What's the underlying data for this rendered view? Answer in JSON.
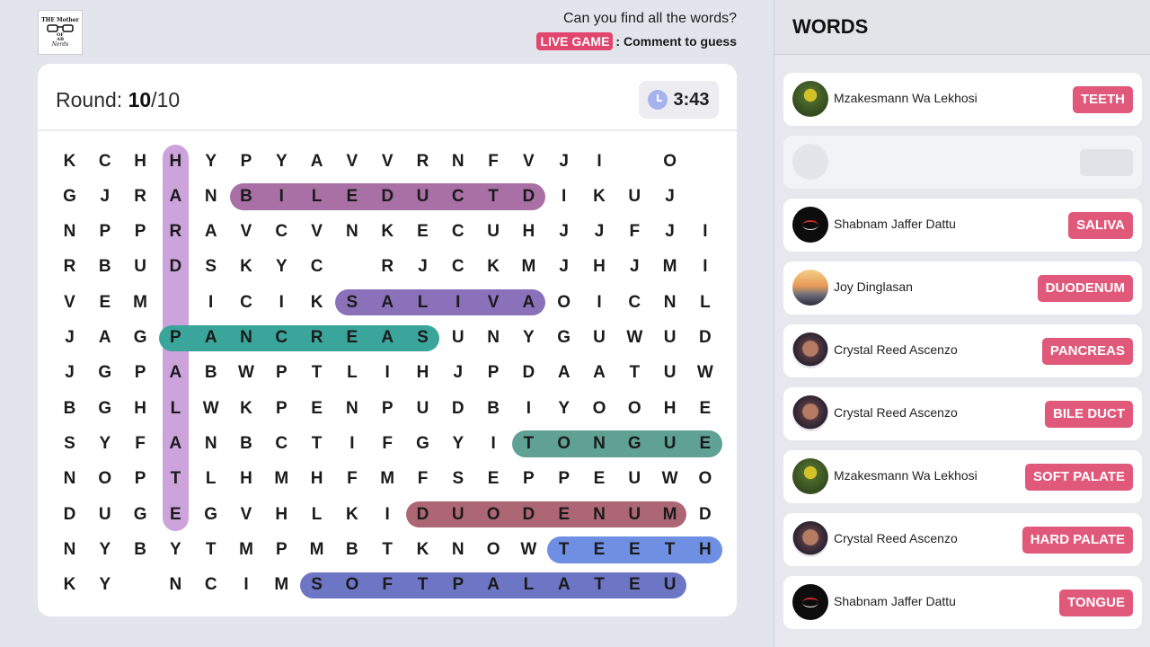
{
  "logo": {
    "line1": "THE Mother",
    "line2": "OF",
    "line3": "AB",
    "line4": "Nerds"
  },
  "header": {
    "tagline": "Can you find all the words?",
    "live_badge": "LIVE GAME",
    "live_text": ": Comment to guess"
  },
  "round": {
    "label": "Round:",
    "current": "10",
    "total": "/10"
  },
  "timer": {
    "value": "3:43"
  },
  "grid": {
    "rows": [
      "KCHHYPYAVVRNFVJI O",
      "GJRANBILEDUCTDIKUJ",
      "NPPRAVCVNKECUHJJFJI",
      "RBUDSKYC RJCKMJHJMI",
      "VEM ICIKSALIVAOICNL",
      "JAGPANCREASUNYGUWUD",
      "JGPABWPTLIHJPDAATUW",
      "BGHLWKPENPUDBIYOOHE",
      "SYFANBCTIFGYITONGUE",
      "NOPTLHMHFMFSEPPEUWO",
      "DUGEGVHLKIDUODENUMD",
      "NYBYTMPMBTKNOWTEETH",
      "KY NCIMSOFTPALATEU"
    ]
  },
  "highlights": [
    {
      "word": "HARD PALATE",
      "row": 0,
      "col": 3,
      "dir": "down",
      "len": 11,
      "color": "#cda3dc"
    },
    {
      "word": "BILE DUCT",
      "row": 1,
      "col": 5,
      "dir": "right",
      "len": 9,
      "color": "#a870a4"
    },
    {
      "word": "SALIVA",
      "row": 4,
      "col": 8,
      "dir": "right",
      "len": 6,
      "color": "#8b71ba"
    },
    {
      "word": "PANCREAS",
      "row": 5,
      "col": 3,
      "dir": "right",
      "len": 8,
      "color": "#3aa59a"
    },
    {
      "word": "TONGUE",
      "row": 8,
      "col": 13,
      "dir": "right",
      "len": 6,
      "color": "#5fa193"
    },
    {
      "word": "DUODENUM",
      "row": 10,
      "col": 10,
      "dir": "right",
      "len": 8,
      "color": "#ad6674"
    },
    {
      "word": "TEETH",
      "row": 11,
      "col": 14,
      "dir": "right",
      "len": 5,
      "color": "#6f8fe3"
    },
    {
      "word": "SOFT PALATE",
      "row": 12,
      "col": 7,
      "dir": "right",
      "len": 11,
      "color": "#6d76c4"
    }
  ],
  "panel": {
    "title": "WORDS",
    "entries": [
      {
        "name": "Mzakesmann Wa Lekhosi",
        "word": "TEETH",
        "avatar": "stadium"
      },
      {
        "name": "",
        "word": "",
        "avatar": "empty"
      },
      {
        "name": "Shabnam Jaffer Dattu",
        "word": "SALIVA",
        "avatar": "dark"
      },
      {
        "name": "Joy Dinglasan",
        "word": "DUODENUM",
        "avatar": "sunset"
      },
      {
        "name": "Crystal Reed Ascenzo",
        "word": "PANCREAS",
        "avatar": "portrait"
      },
      {
        "name": "Crystal Reed Ascenzo",
        "word": "BILE DUCT",
        "avatar": "portrait"
      },
      {
        "name": "Mzakesmann Wa Lekhosi",
        "word": "SOFT PALATE",
        "avatar": "stadium"
      },
      {
        "name": "Crystal Reed Ascenzo",
        "word": "HARD PALATE",
        "avatar": "portrait"
      },
      {
        "name": "Shabnam Jaffer Dattu",
        "word": "TONGUE",
        "avatar": "dark"
      }
    ]
  }
}
